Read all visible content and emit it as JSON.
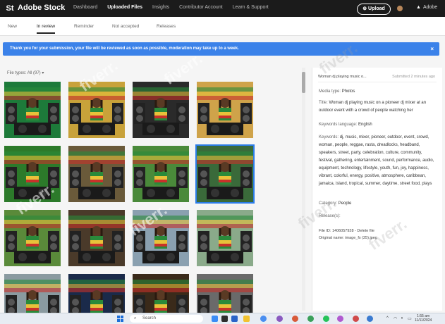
{
  "app": {
    "brand": "Adobe Stock",
    "badge": "St"
  },
  "nav": [
    "Dashboard",
    "Uploaded Files",
    "Insights",
    "Contributor Account",
    "Learn & Support"
  ],
  "upload_label": "Upload",
  "adobe_label": "Adobe",
  "tabs": [
    "New",
    "In review",
    "Reminder",
    "Not accepted",
    "Releases"
  ],
  "banner": {
    "message": "Thank you for your submission, your file will be reviewed as soon as possible, moderation may take up to a week.",
    "close": "×"
  },
  "filter": {
    "label": "File types: All (97)"
  },
  "thumbnails": [
    {
      "name": "thumb-1",
      "sky": "#1d7a3a"
    },
    {
      "name": "thumb-2",
      "sky": "#c8a23a"
    },
    {
      "name": "thumb-3",
      "sky": "#2a2a2a"
    },
    {
      "name": "thumb-4",
      "sky": "#cfa34a"
    },
    {
      "name": "thumb-5",
      "sky": "#2c7a2a"
    },
    {
      "name": "thumb-6",
      "sky": "#6a5a3a"
    },
    {
      "name": "thumb-7",
      "sky": "#4a8a3a"
    },
    {
      "name": "thumb-8",
      "sky": "#3a6a3a"
    },
    {
      "name": "thumb-9",
      "sky": "#5a8a3a"
    },
    {
      "name": "thumb-10",
      "sky": "#4a3a2a"
    },
    {
      "name": "thumb-11",
      "sky": "#8aa0b0"
    },
    {
      "name": "thumb-12",
      "sky": "#8aaa8a"
    },
    {
      "name": "thumb-13",
      "sky": "#8a9aa0"
    },
    {
      "name": "thumb-14",
      "sky": "#1a2a4a"
    },
    {
      "name": "thumb-15",
      "sky": "#3a2a1a"
    },
    {
      "name": "thumb-16",
      "sky": "#6a6a6a"
    }
  ],
  "panel": {
    "filename": "Woman dj playing music o...",
    "submitted": "Submitted 2 minutes ago",
    "media_type": {
      "key": "Media type:",
      "value": "Photos"
    },
    "title": {
      "key": "Title:",
      "value": "Woman dj playing music on a pioneer dj mixer at an outdoor event with a crowd of people watching her"
    },
    "keywords_language": {
      "key": "Keywords language:",
      "value": "English"
    },
    "keywords": {
      "key": "Keywords:",
      "value": "dj, music, mixer, pioneer, outdoor, event, crowd, woman, people, reggae, rasta, dreadlocks, headband, speakers, street, party, celebration, culture, community, festival, gathering, entertainment, sound, performance, audio, equipment, technology, lifestyle, youth, fun, joy, happiness, vibrant, colorful, energy, positive, atmosphere, caribbean, jamaica, island, tropical, summer, daytime, street food, plays"
    },
    "category": {
      "key": "Category:",
      "value": "People"
    },
    "releases": {
      "key": "Release(s):"
    },
    "file_id": "File ID: 1406057928 - Delete file",
    "original_name": "Original name: image_fx (25).jpeg"
  },
  "taskbar": {
    "search_placeholder": "Search",
    "time": "1:55 am",
    "date": "11/11/2024"
  },
  "watermark": "fiverr.",
  "colors": {
    "accent": "#3b82e9",
    "topbar": "#1b1b1b",
    "selected": "#2b7de9"
  }
}
